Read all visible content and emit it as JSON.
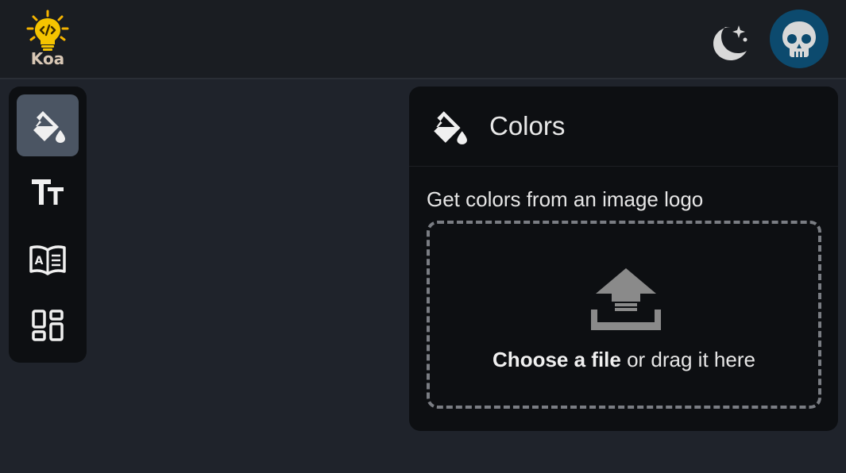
{
  "app": {
    "logo_text": "Koa",
    "accent": "#f5c400",
    "avatar_bg": "#0c4a6e"
  },
  "sidebar": {
    "items": [
      {
        "icon": "paint-bucket-icon",
        "active": true
      },
      {
        "icon": "text-size-icon",
        "active": false
      },
      {
        "icon": "book-icon",
        "active": false
      },
      {
        "icon": "dashboard-icon",
        "active": false
      }
    ]
  },
  "panel": {
    "title": "Colors",
    "subtitle": "Get colors from an image logo",
    "dropzone": {
      "choose_label": "Choose a file",
      "drag_label": " or drag it here"
    }
  }
}
